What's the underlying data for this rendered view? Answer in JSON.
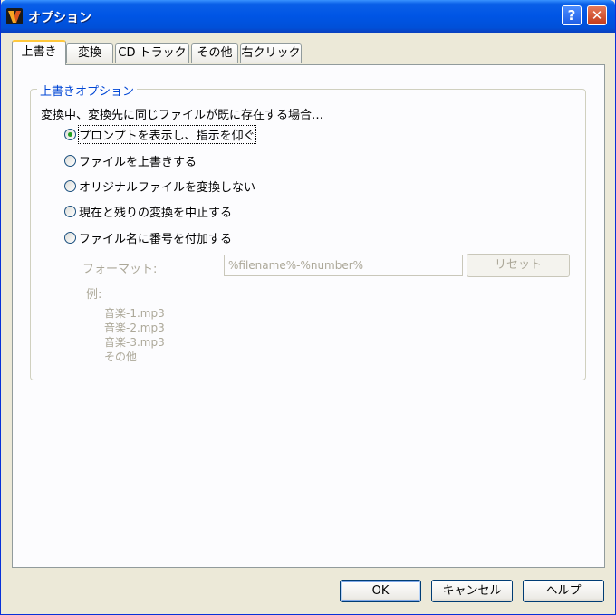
{
  "window": {
    "title": "オプション",
    "help_glyph": "?",
    "close_glyph": "✕"
  },
  "tabs": [
    {
      "label": "上書き",
      "active": true
    },
    {
      "label": "変換",
      "active": false
    },
    {
      "label": "CD トラック",
      "active": false
    },
    {
      "label": "その他",
      "active": false
    },
    {
      "label": "右クリック",
      "active": false
    }
  ],
  "overwrite_group": {
    "legend": "上書きオプション",
    "intro": "変換中、変換先に同じファイルが既に存在する場合…",
    "options": [
      {
        "label": "プロンプトを表示し、指示を仰ぐ",
        "selected": true
      },
      {
        "label": "ファイルを上書きする",
        "selected": false
      },
      {
        "label": "オリジナルファイルを変換しない",
        "selected": false
      },
      {
        "label": "現在と残りの変換を中止する",
        "selected": false
      },
      {
        "label": "ファイル名に番号を付加する",
        "selected": false
      }
    ],
    "format_label": "フォーマット:",
    "format_value": "%filename%-%number%",
    "reset_label": "リセット",
    "example_label": "例:",
    "examples": [
      "音楽-1.mp3",
      "音楽-2.mp3",
      "音楽-3.mp3",
      "その他"
    ]
  },
  "footer": {
    "ok_label": "OK",
    "cancel_label": "キャンセル",
    "help_label": "ヘルプ"
  },
  "colors": {
    "titlebar": "#0055E5",
    "legend": "#0046D5",
    "active_tab_accent": "#FFC83C",
    "radio_dot": "#21A121"
  }
}
